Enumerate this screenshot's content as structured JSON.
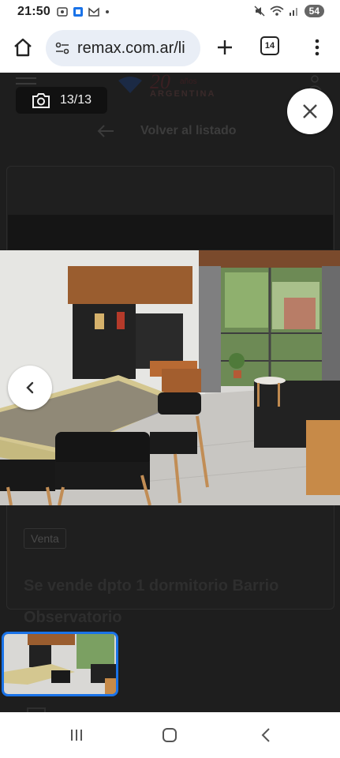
{
  "status_bar": {
    "time": "21:50",
    "battery": "54"
  },
  "browser": {
    "url": "remax.com.ar/li",
    "tab_count": "14"
  },
  "page": {
    "logo_subtext": "ARGENTINA",
    "back_label": "Volver al listado",
    "badge": "Venta",
    "title": "Se vende dpto 1 dormitorio Barrio Observatorio"
  },
  "gallery": {
    "counter": "13/13"
  },
  "colors": {
    "accent": "#1a73e8",
    "overlay": "#1c1c1c"
  }
}
